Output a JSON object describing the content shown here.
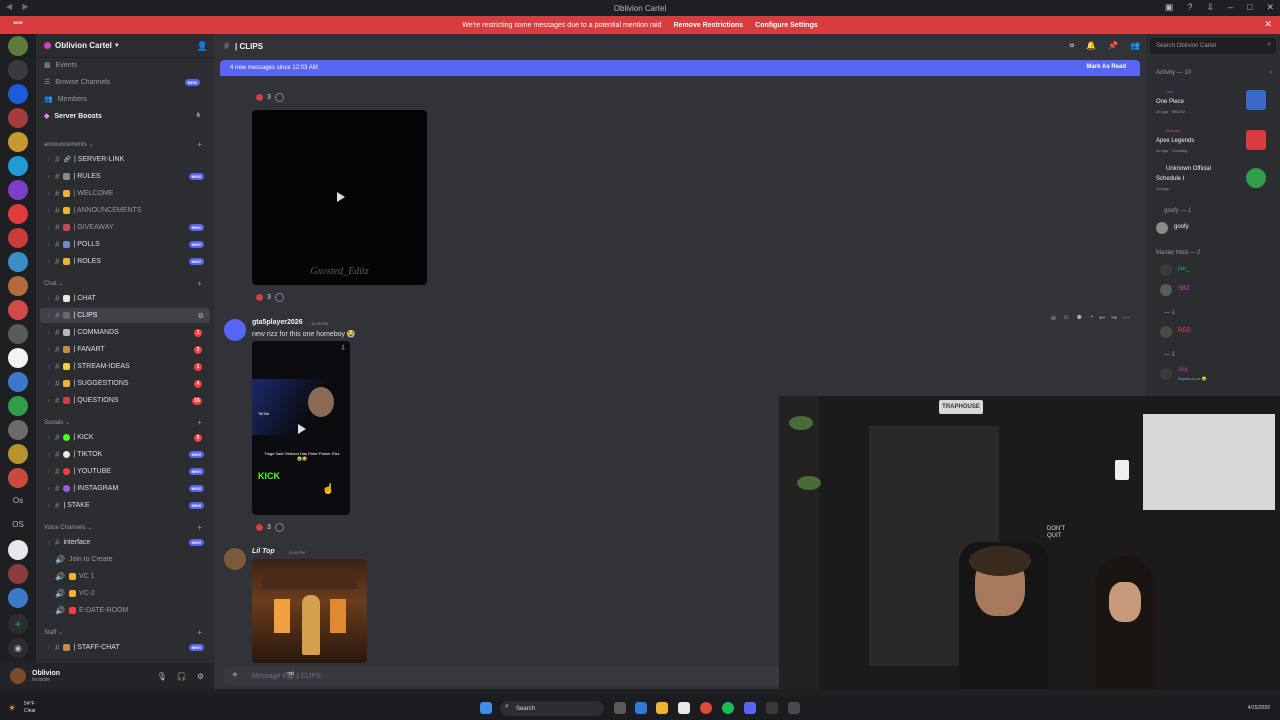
{
  "window": {
    "title": "Oblivion Cartel"
  },
  "banner": {
    "text": "We're restricting some messages due to a potential mention raid",
    "remove_link": "Remove Restrictions",
    "configure_link": "Configure Settings"
  },
  "rail": {
    "new_badge": "NEW",
    "os_label_1": "Os",
    "os_label_2": "OS"
  },
  "server": {
    "name": "Oblivion Cartel",
    "top_items": [
      {
        "label": "Events"
      },
      {
        "label": "Browse Channels",
        "badge": "NEW"
      },
      {
        "label": "Members"
      },
      {
        "label": "Server Boosts",
        "badge": "6"
      }
    ],
    "categories": {
      "announcements": "announcements",
      "chat": "Chat",
      "socials": "Socials",
      "voice": "Voice Channels",
      "staff": "Staff"
    },
    "announcement_channels": [
      {
        "name": "| SERVER-LINK"
      },
      {
        "name": "| RULES",
        "badge": "NEW"
      },
      {
        "name": "| WELCOME"
      },
      {
        "name": "| ANNOUNCEMENTS"
      },
      {
        "name": "| GIVEAWAY",
        "badge": "NEW"
      },
      {
        "name": "| POLLS",
        "badge": "NEW"
      },
      {
        "name": "| ROLES",
        "badge": "NEW"
      }
    ],
    "chat_channels": [
      {
        "name": "| CHAT"
      },
      {
        "name": "| CLIPS"
      },
      {
        "name": "| COMMANDS",
        "count": "1"
      },
      {
        "name": "| FANART",
        "count": "2"
      },
      {
        "name": "| STREAM-IDEAS",
        "count": "1"
      },
      {
        "name": "| SUGGESTIONS",
        "count": "4"
      },
      {
        "name": "| QUESTIONS",
        "count": "16"
      }
    ],
    "social_channels": [
      {
        "name": "| KICK",
        "count": "9"
      },
      {
        "name": "| TIKTOK",
        "badge": "NEW"
      },
      {
        "name": "| YOUTUBE",
        "badge": "NEW"
      },
      {
        "name": "| INSTAGRAM",
        "badge": "NEW"
      },
      {
        "name": "| STAKE",
        "badge": "NEW"
      }
    ],
    "voice_channels": [
      {
        "name": "interface",
        "badge": "NEW"
      },
      {
        "name": "Join to Create"
      },
      {
        "name": "VC 1"
      },
      {
        "name": "VC-2"
      },
      {
        "name": "E-DATE-ROOM"
      }
    ],
    "staff_channels": [
      {
        "name": "| STAFF-CHAT",
        "badge": "NEW"
      }
    ]
  },
  "user": {
    "name": "Oblivion",
    "status": "Invisible"
  },
  "chat": {
    "channel": "| CLIPS",
    "new_messages": "4 new messages since 12:03 AM",
    "mark_as_read": "Mark As Read",
    "messages": [
      {
        "reaction_count": "3"
      },
      {
        "watermark": "Gxosted_Editz",
        "reaction_count": "3"
      },
      {
        "author": "gta5player2026",
        "time": "11:45 PM",
        "text": "new rizz for this one homeboy 😭",
        "video_caption": "Tiago Said Oblivion Has Peter Parker Rizz 😭😂",
        "kick_label": "KICK",
        "tiktok_label": "TikTok",
        "reaction_count": "3"
      },
      {
        "author": "Lil Top",
        "time": "11:45 PM"
      }
    ],
    "input_placeholder": "Message #🎬 | CLIPS"
  },
  "activity": {
    "search_placeholder": "Search Oblivion Cartel",
    "header": "Activity — 10",
    "items": [
      {
        "user": "rawr",
        "title": "One Piece",
        "meta": "2h ago · 556202"
      },
      {
        "user": "Mommy",
        "title": "Apex Legends",
        "meta": "4d ago · Trending"
      },
      {
        "user": "Unknown Official",
        "title": "Schedule I",
        "meta": "2w ago"
      }
    ],
    "goofy_group": "goofy — 1",
    "goofy_member": "goofy",
    "master_group": "Master Mod — 2",
    "master_members": [
      "jae_",
      "SBZ"
    ],
    "group_3": "— 1",
    "member_3": "RED",
    "group_4": "— 1",
    "member_4": "cruj",
    "member_4_status": "Bayanna yur 😂"
  },
  "webcam": {
    "sign": "TRAPHOUSE",
    "sign_2": "DON'T QUIT"
  },
  "taskbar": {
    "temp": "54°F",
    "weather": "Clear",
    "search": "Search",
    "date": "4/15/2026"
  },
  "colors": {
    "accent": "#5865f2",
    "danger": "#d83c3e",
    "sidebar": "#2b2d31",
    "chat_bg": "#313338"
  }
}
